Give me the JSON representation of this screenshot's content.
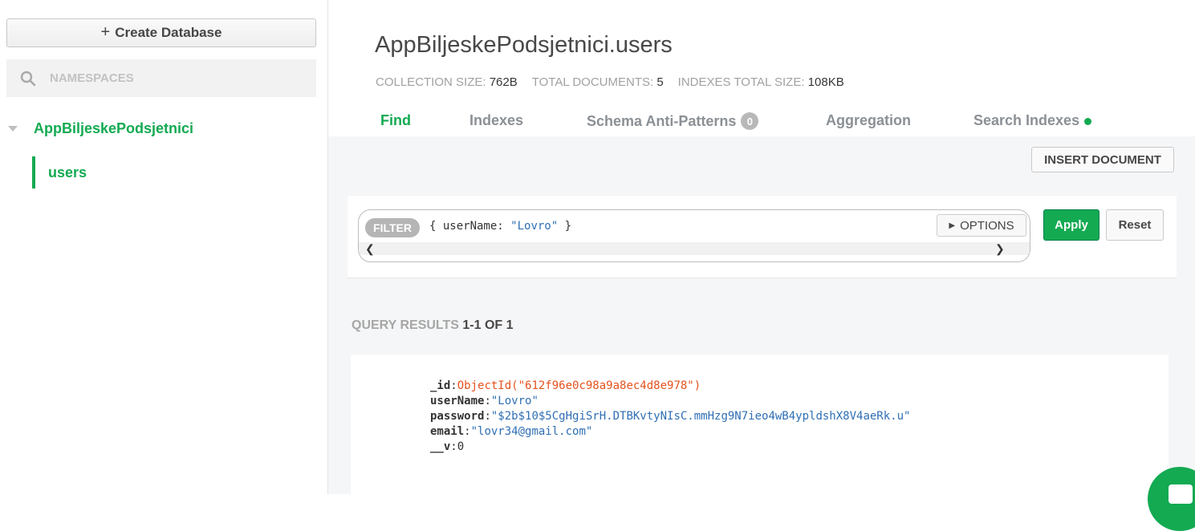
{
  "sidebar": {
    "create_label": "Create Database",
    "namespaces_placeholder": "NAMESPACES",
    "database": "AppBiljeskePodsjetnici",
    "collection": "users"
  },
  "header": {
    "title": "AppBiljeskePodsjetnici.users",
    "stats": [
      {
        "label": "COLLECTION SIZE:",
        "value": "762B"
      },
      {
        "label": "TOTAL DOCUMENTS:",
        "value": "5"
      },
      {
        "label": "INDEXES TOTAL SIZE:",
        "value": "108KB"
      }
    ]
  },
  "tabs": [
    {
      "label": "Find",
      "active": true
    },
    {
      "label": "Indexes"
    },
    {
      "label": "Schema Anti-Patterns",
      "badge": "0"
    },
    {
      "label": "Aggregation"
    },
    {
      "label": "Search Indexes"
    }
  ],
  "toolbar": {
    "insert_label": "INSERT DOCUMENT"
  },
  "query": {
    "filter_label": "FILTER",
    "filter_prefix": "{ userName: ",
    "filter_value": "\"Lovro\"",
    "filter_suffix": " }",
    "options_label": "OPTIONS",
    "apply_label": "Apply",
    "reset_label": "Reset"
  },
  "results": {
    "label": "QUERY RESULTS",
    "range": "1-1 OF 1"
  },
  "document": {
    "fields": [
      {
        "key": "_id",
        "value": "ObjectId(\"612f96e0c98a9a8ec4d8e978\")",
        "type": "oid"
      },
      {
        "key": "userName",
        "value": "\"Lovro\"",
        "type": "str"
      },
      {
        "key": "password",
        "value": "\"$2b$10$5CgHgiSrH.DTBKvtyNIsC.mmHzg9N7ieo4wB4ypldshX8V4aeRk.u\"",
        "type": "str"
      },
      {
        "key": "email",
        "value": "\"lovr34@gmail.com\"",
        "type": "str"
      },
      {
        "key": "__v",
        "value": "0",
        "type": "num"
      }
    ]
  },
  "colors": {
    "accent": "#13aa52",
    "oid": "#e5521e",
    "string": "#2f6fb3"
  }
}
